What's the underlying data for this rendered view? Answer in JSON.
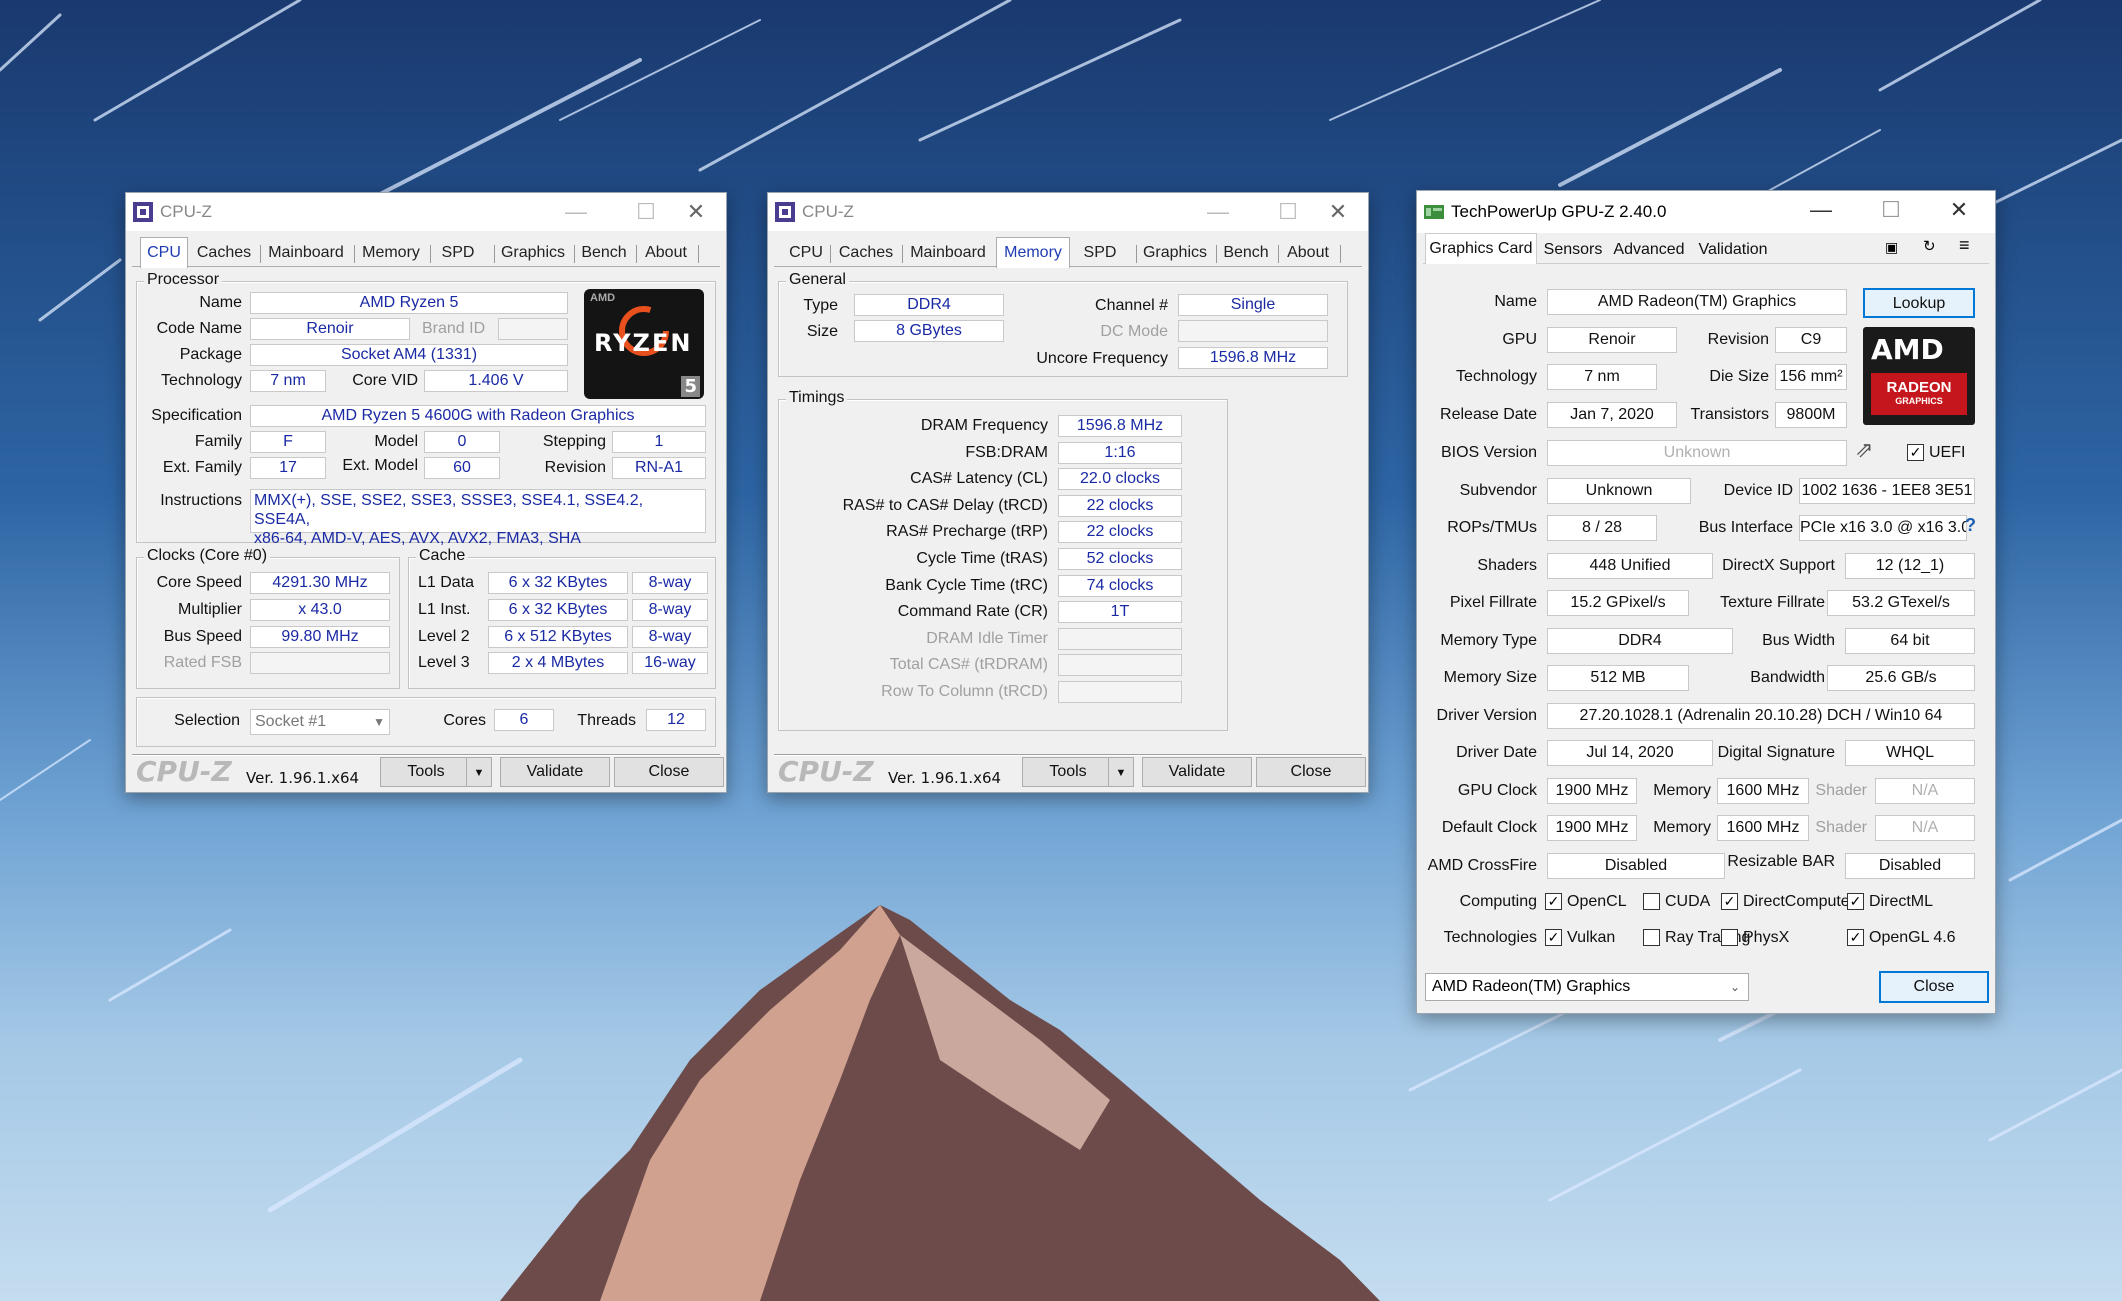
{
  "cpuz_cpu": {
    "title": "CPU-Z",
    "tabs": [
      "CPU",
      "Caches",
      "Mainboard",
      "Memory",
      "SPD",
      "Graphics",
      "Bench",
      "About"
    ],
    "processor": {
      "group": "Processor",
      "name_label": "Name",
      "name": "AMD Ryzen 5",
      "codename_label": "Code Name",
      "codename": "Renoir",
      "brandid_label": "Brand ID",
      "brandid": "",
      "package_label": "Package",
      "package": "Socket AM4 (1331)",
      "technology_label": "Technology",
      "technology": "7 nm",
      "corevid_label": "Core VID",
      "corevid": "1.406 V",
      "spec_label": "Specification",
      "spec": "AMD Ryzen 5 4600G with Radeon Graphics",
      "family_label": "Family",
      "family": "F",
      "model_label": "Model",
      "model": "0",
      "stepping_label": "Stepping",
      "stepping": "1",
      "extfamily_label": "Ext. Family",
      "extfamily": "17",
      "extmodel_label": "Ext. Model",
      "extmodel": "60",
      "revision_label": "Revision",
      "revision": "RN-A1",
      "instructions_label": "Instructions",
      "instructions_line1": "MMX(+), SSE, SSE2, SSE3, SSSE3, SSE4.1, SSE4.2, SSE4A,",
      "instructions_line2": "x86-64, AMD-V, AES, AVX, AVX2, FMA3, SHA"
    },
    "logo": {
      "brand": "AMD",
      "text": "RYZEN",
      "digit": "5"
    },
    "clocks": {
      "group": "Clocks (Core #0)",
      "corespeed_label": "Core Speed",
      "corespeed": "4291.30 MHz",
      "multiplier_label": "Multiplier",
      "multiplier": "x 43.0",
      "busspeed_label": "Bus Speed",
      "busspeed": "99.80 MHz",
      "ratedfsb_label": "Rated FSB",
      "ratedfsb": ""
    },
    "cache": {
      "group": "Cache",
      "l1data_label": "L1 Data",
      "l1data": "6 x 32 KBytes",
      "l1data_way": "8-way",
      "l1inst_label": "L1 Inst.",
      "l1inst": "6 x 32 KBytes",
      "l1inst_way": "8-way",
      "l2_label": "Level 2",
      "l2": "6 x 512 KBytes",
      "l2_way": "8-way",
      "l3_label": "Level 3",
      "l3": "2 x 4 MBytes",
      "l3_way": "16-way"
    },
    "selection": {
      "label": "Selection",
      "value": "Socket #1",
      "cores_label": "Cores",
      "cores": "6",
      "threads_label": "Threads",
      "threads": "12"
    },
    "footer": {
      "logo": "CPU-Z",
      "version": "Ver. 1.96.1.x64",
      "tools": "Tools",
      "validate": "Validate",
      "close": "Close"
    }
  },
  "cpuz_mem": {
    "title": "CPU-Z",
    "tabs": [
      "CPU",
      "Caches",
      "Mainboard",
      "Memory",
      "SPD",
      "Graphics",
      "Bench",
      "About"
    ],
    "general": {
      "group": "General",
      "type_label": "Type",
      "type": "DDR4",
      "size_label": "Size",
      "size": "8 GBytes",
      "channel_label": "Channel #",
      "channel": "Single",
      "dcmode_label": "DC Mode",
      "dcmode": "",
      "uncore_label": "Uncore Frequency",
      "uncore": "1596.8 MHz"
    },
    "timings": {
      "group": "Timings",
      "rows": [
        {
          "label": "DRAM Frequency",
          "value": "1596.8 MHz",
          "dim": false
        },
        {
          "label": "FSB:DRAM",
          "value": "1:16",
          "dim": false
        },
        {
          "label": "CAS# Latency (CL)",
          "value": "22.0 clocks",
          "dim": false
        },
        {
          "label": "RAS# to CAS# Delay (tRCD)",
          "value": "22 clocks",
          "dim": false
        },
        {
          "label": "RAS# Precharge (tRP)",
          "value": "22 clocks",
          "dim": false
        },
        {
          "label": "Cycle Time (tRAS)",
          "value": "52 clocks",
          "dim": false
        },
        {
          "label": "Bank Cycle Time (tRC)",
          "value": "74 clocks",
          "dim": false
        },
        {
          "label": "Command Rate (CR)",
          "value": "1T",
          "dim": false
        },
        {
          "label": "DRAM Idle Timer",
          "value": "",
          "dim": true
        },
        {
          "label": "Total CAS# (tRDRAM)",
          "value": "",
          "dim": true
        },
        {
          "label": "Row To Column (tRCD)",
          "value": "",
          "dim": true
        }
      ]
    },
    "footer": {
      "logo": "CPU-Z",
      "version": "Ver. 1.96.1.x64",
      "tools": "Tools",
      "validate": "Validate",
      "close": "Close"
    }
  },
  "gpuz": {
    "title": "TechPowerUp GPU-Z 2.40.0",
    "tabs": [
      "Graphics Card",
      "Sensors",
      "Advanced",
      "Validation"
    ],
    "name_label": "Name",
    "name": "AMD Radeon(TM) Graphics",
    "lookup": "Lookup",
    "gpu_label": "GPU",
    "gpu": "Renoir",
    "revision_label": "Revision",
    "revision": "C9",
    "technology_label": "Technology",
    "technology": "7 nm",
    "diesize_label": "Die Size",
    "diesize": "156 mm²",
    "release_label": "Release Date",
    "release": "Jan 7, 2020",
    "transistors_label": "Transistors",
    "transistors": "9800M",
    "bios_label": "BIOS Version",
    "bios": "Unknown",
    "uefi_label": "UEFI",
    "subvendor_label": "Subvendor",
    "subvendor": "Unknown",
    "deviceid_label": "Device ID",
    "deviceid": "1002 1636 - 1EE8 3E51",
    "rops_label": "ROPs/TMUs",
    "rops": "8 / 28",
    "businterface_label": "Bus Interface",
    "businterface": "PCIe x16 3.0 @ x16 3.0",
    "help": "?",
    "shaders_label": "Shaders",
    "shaders": "448 Unified",
    "directx_label": "DirectX Support",
    "directx": "12 (12_1)",
    "pixel_label": "Pixel Fillrate",
    "pixel": "15.2 GPixel/s",
    "texture_label": "Texture Fillrate",
    "texture": "53.2 GTexel/s",
    "memtype_label": "Memory Type",
    "memtype": "DDR4",
    "buswidth_label": "Bus Width",
    "buswidth": "64 bit",
    "memsize_label": "Memory Size",
    "memsize": "512 MB",
    "bandwidth_label": "Bandwidth",
    "bandwidth": "25.6 GB/s",
    "driverver_label": "Driver Version",
    "driverver": "27.20.1028.1 (Adrenalin 20.10.28) DCH / Win10 64",
    "driverdate_label": "Driver Date",
    "driverdate": "Jul 14, 2020",
    "digsig_label": "Digital Signature",
    "digsig": "WHQL",
    "gpuclock_label": "GPU Clock",
    "gpuclock": "1900 MHz",
    "memory_label": "Memory",
    "gpuclock_mem": "1600 MHz",
    "shader_label": "Shader",
    "gpuclock_shader": "N/A",
    "defclock_label": "Default Clock",
    "defclock": "1900 MHz",
    "defclock_mem": "1600 MHz",
    "defclock_shader": "N/A",
    "crossfire_label": "AMD CrossFire",
    "crossfire": "Disabled",
    "rebar_label": "Resizable BAR",
    "rebar": "Disabled",
    "computing_label": "Computing",
    "technologies_label": "Technologies",
    "computing": [
      {
        "label": "OpenCL",
        "checked": true
      },
      {
        "label": "CUDA",
        "checked": false
      },
      {
        "label": "DirectCompute",
        "checked": true
      },
      {
        "label": "DirectML",
        "checked": true
      }
    ],
    "technologies": [
      {
        "label": "Vulkan",
        "checked": true
      },
      {
        "label": "Ray Tracing",
        "checked": false
      },
      {
        "label": "PhysX",
        "checked": false
      },
      {
        "label": "OpenGL 4.6",
        "checked": true
      }
    ],
    "select": "AMD Radeon(TM) Graphics",
    "close": "Close",
    "logo": {
      "brand": "AMD",
      "line1": "RADEON",
      "line2": "GRAPHICS"
    }
  }
}
